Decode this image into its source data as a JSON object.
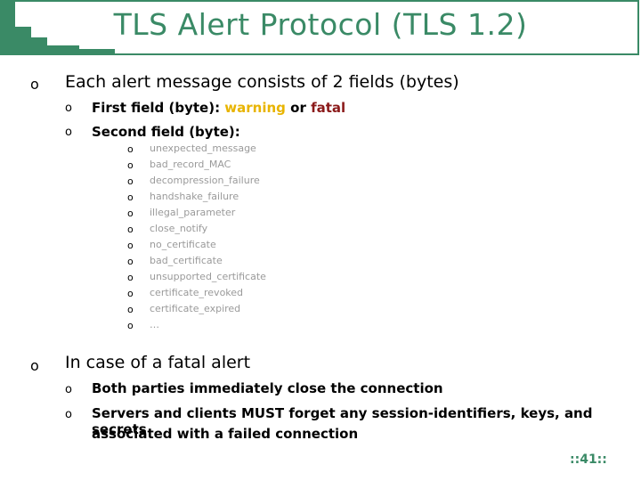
{
  "slide": {
    "title": "TLS Alert Protocol (TLS 1.2)",
    "bullet_glyph": "o",
    "points": [
      {
        "text": "Each alert message consists of 2 fields (bytes)",
        "sub": [
          {
            "prefix": "First field (byte): ",
            "warning": "warning",
            "mid": " or ",
            "fatal": "fatal"
          },
          {
            "text": "Second field (byte):",
            "sub": [
              "unexpected_message",
              "bad_record_MAC",
              "decompression_failure",
              "handshake_failure",
              "illegal_parameter",
              "close_notify",
              "no_certificate",
              "bad_certificate",
              "unsupported_certificate",
              "certificate_revoked",
              "certificate_expired",
              "…"
            ]
          }
        ]
      },
      {
        "text": "In case of a fatal alert",
        "sub": [
          {
            "text": "Both parties immediately close the connection"
          },
          {
            "text": "Servers and clients MUST forget any session-identifiers, keys, and secrets",
            "continuation": "associated with a failed connection"
          }
        ]
      }
    ],
    "page_number": "::41::",
    "colors": {
      "accent": "#3a8a66",
      "warning": "#e8b400",
      "fatal": "#8b1a1a",
      "muted": "#9a9a9a"
    }
  }
}
